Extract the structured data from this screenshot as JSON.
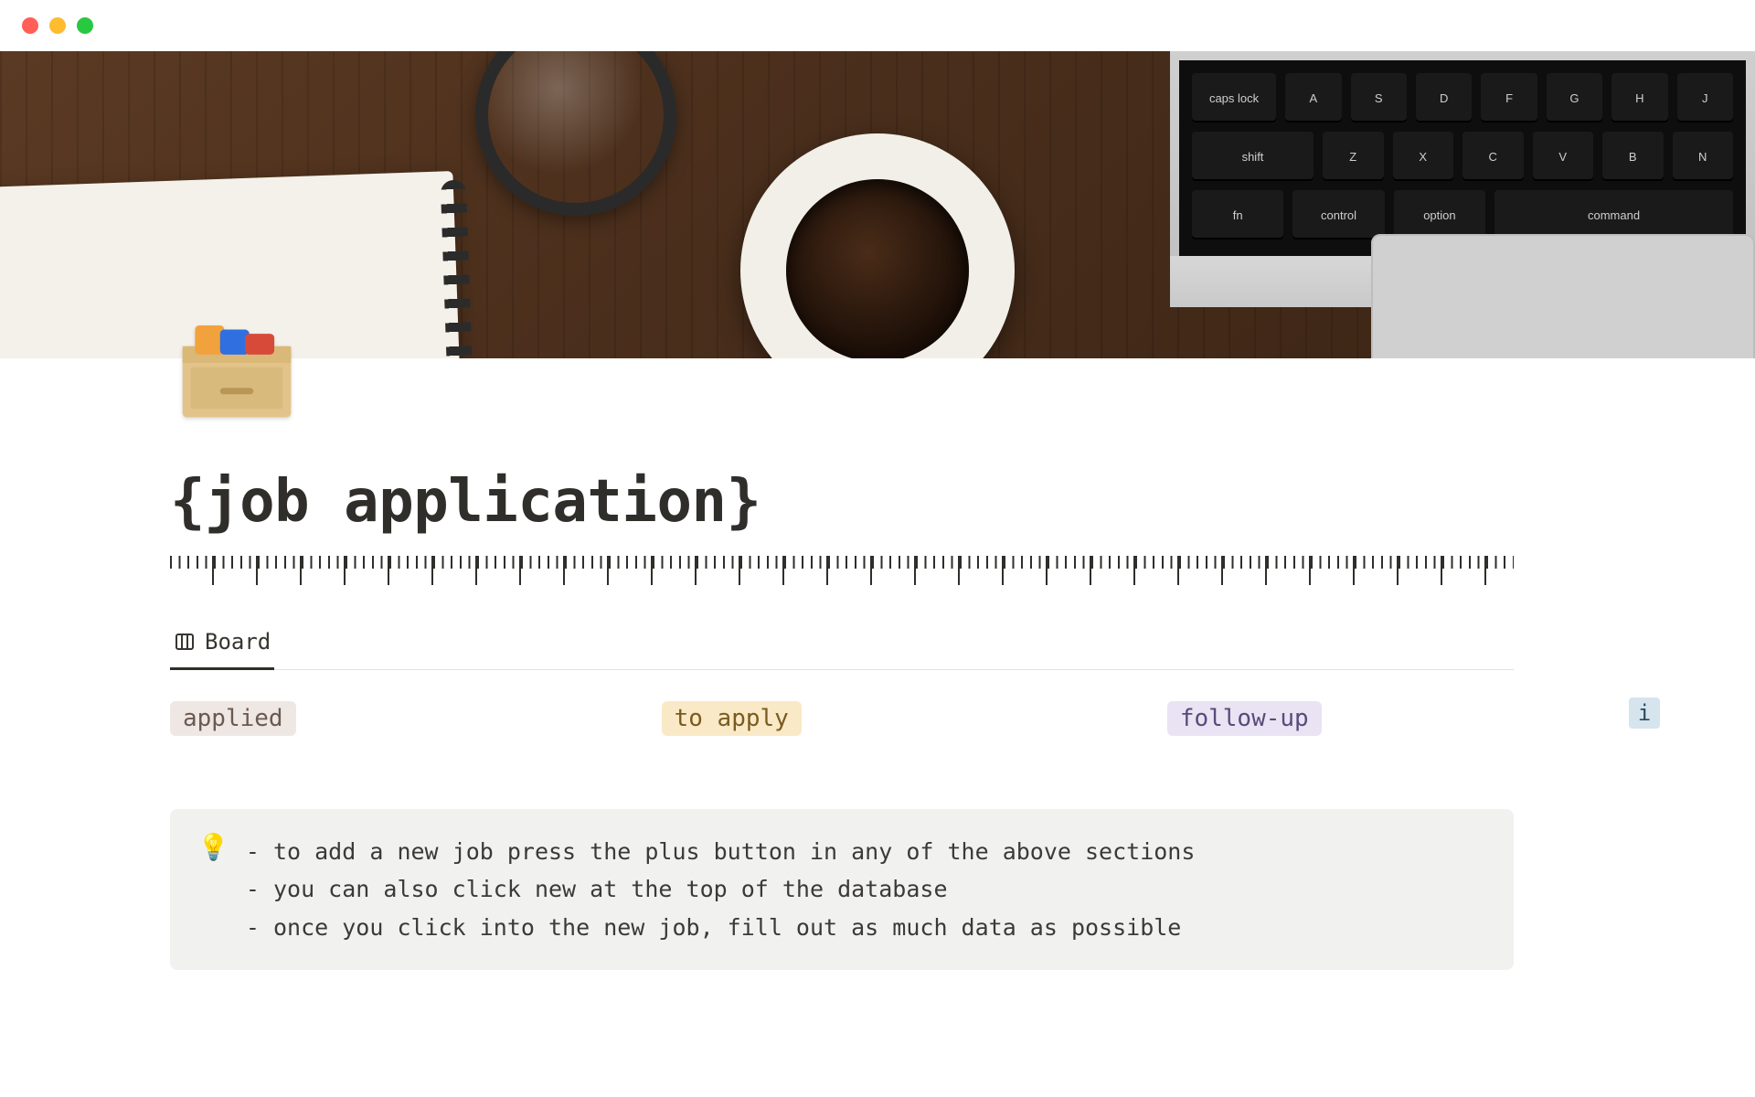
{
  "page": {
    "icon_name": "card-file-box-icon",
    "title": "{job application}"
  },
  "view": {
    "tab_label": "Board"
  },
  "board": {
    "columns": [
      {
        "label": "applied",
        "tone": "applied"
      },
      {
        "label": "to apply",
        "tone": "to-apply"
      },
      {
        "label": "follow-up",
        "tone": "follow-up"
      }
    ]
  },
  "info_button": {
    "glyph": "i"
  },
  "callout": {
    "icon": "💡",
    "lines": [
      "- to add a new job press the plus button in any of the above sections",
      "- you can also click new at the top of the database",
      "- once you click into the new job, fill out as much data as possible"
    ]
  },
  "cover": {
    "keyboard": {
      "row1": [
        "caps lock",
        "A",
        "S",
        "D",
        "F",
        "G",
        "H",
        "J"
      ],
      "row2": [
        "shift",
        "Z",
        "X",
        "C",
        "V",
        "B",
        "N"
      ],
      "row3": [
        "fn",
        "control",
        "option",
        "command"
      ]
    }
  }
}
